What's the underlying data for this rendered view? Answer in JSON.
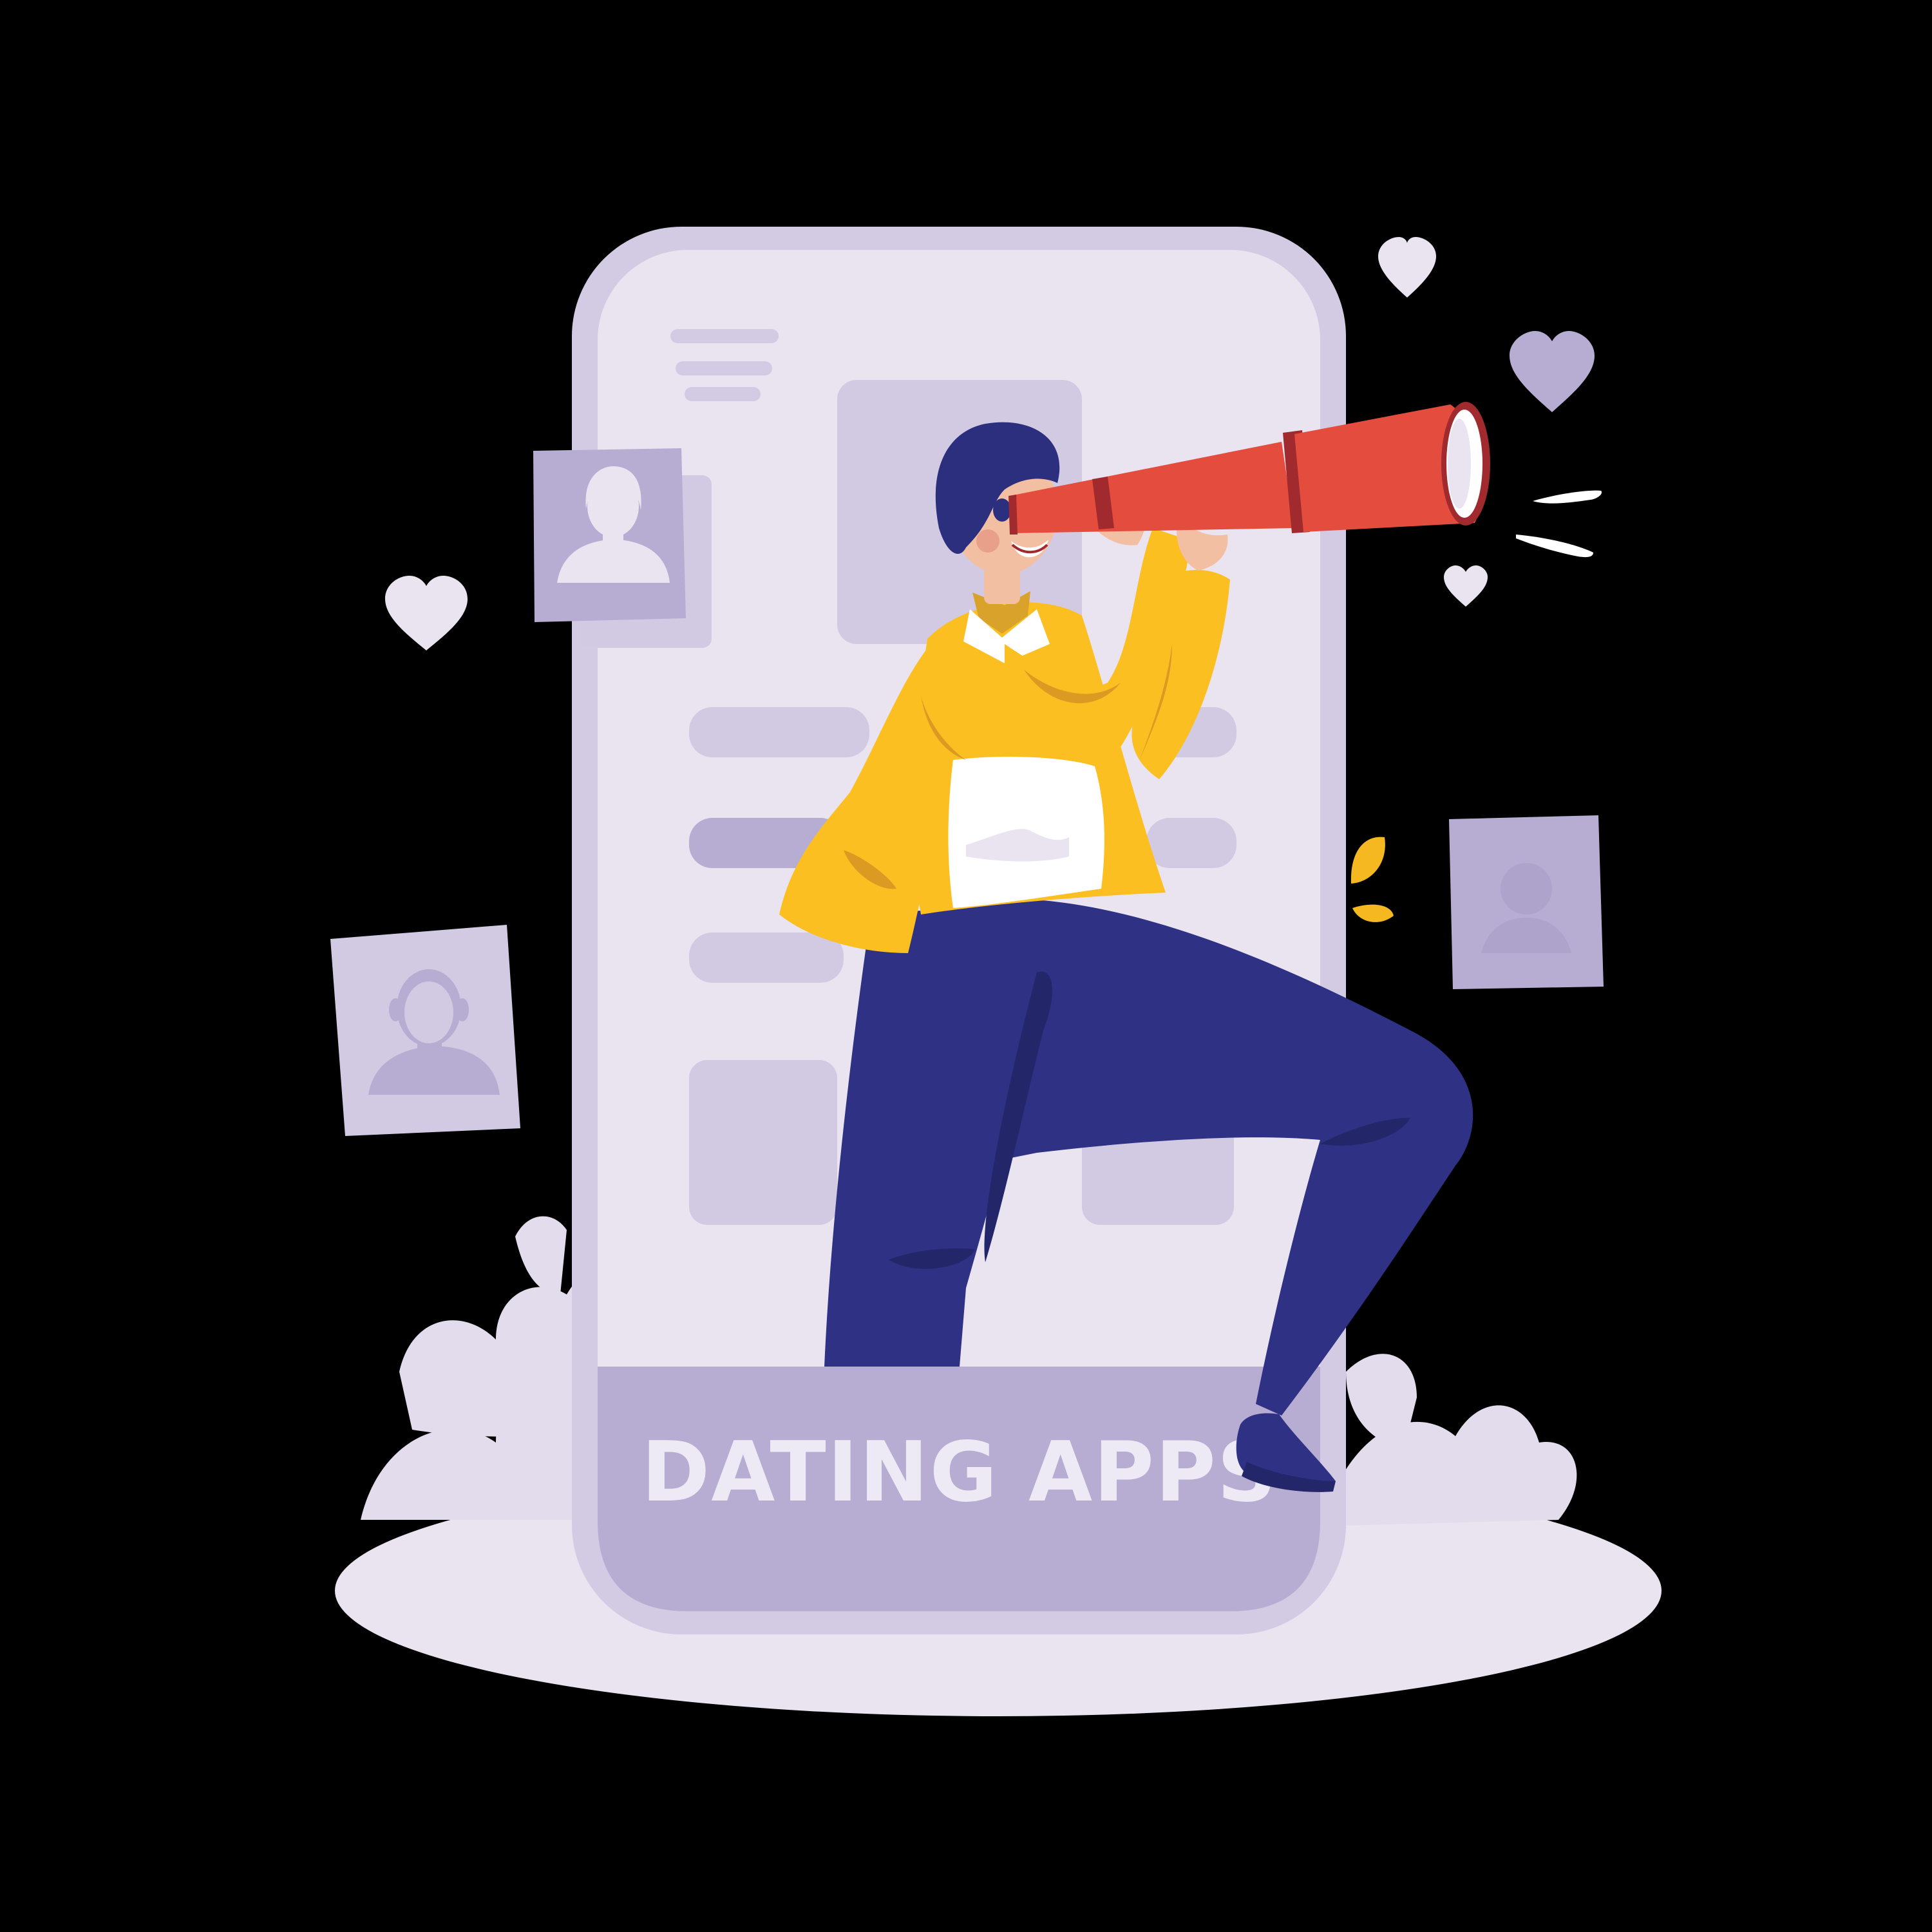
{
  "banner": {
    "label": "DATING APPS"
  },
  "colors": {
    "background": "#000000",
    "phone_frame": "#D3CBE3",
    "phone_screen": "#EAE4F1",
    "screen_block": "#D2CAE2",
    "banner_fill": "#B7ADD2",
    "banner_text": "#EEEAF5",
    "ground": "#EAE4F1",
    "bush": "#E3DCEC",
    "profile_card": "#B7ADD2",
    "profile_card_back": "#D2CAE2",
    "avatar_silhouette": "#EAE4F1",
    "heart_light": "#EAE4F1",
    "heart_dark": "#B7ADD2",
    "jacket": "#FBBF22",
    "jacket_shadow": "#DB9B22",
    "pants": "#2E3184",
    "pants_shadow": "#23276A",
    "hair": "#2C2E7E",
    "skin": "#F2BFA2",
    "shirt": "#FFFFFF",
    "collar": "#D9A22A",
    "telescope": "#E44C3E",
    "telescope_rim": "#A02A2E",
    "shoe": "#2E3184",
    "leaf": "#F5B820"
  },
  "icons": [
    "phone-menu-icon",
    "female-avatar-icon",
    "male-avatar-icon",
    "user-photo-icon",
    "heart-icon",
    "telescope-icon",
    "leaf-icon"
  ]
}
